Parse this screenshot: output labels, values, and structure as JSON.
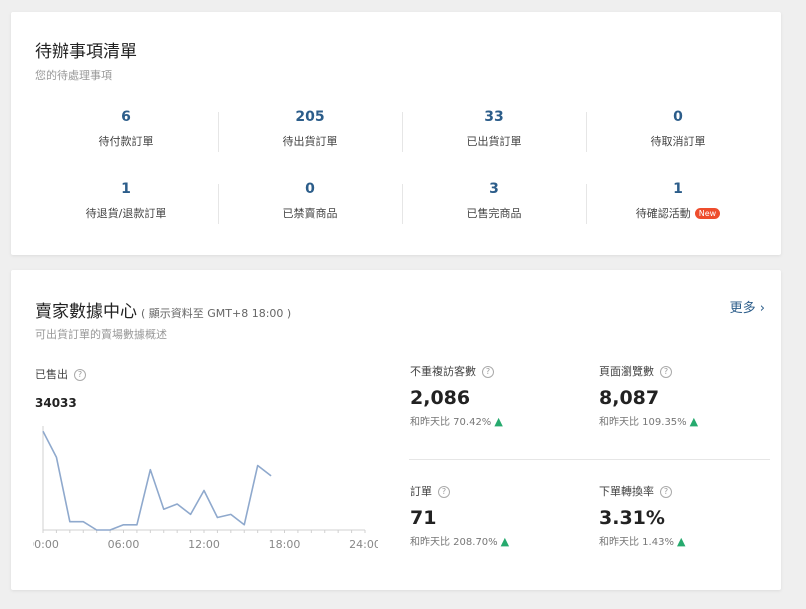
{
  "todo": {
    "title": "待辦事項清單",
    "subtitle": "您的待處理事項",
    "items": [
      {
        "value": "6",
        "label": "待付款訂單"
      },
      {
        "value": "205",
        "label": "待出貨訂單"
      },
      {
        "value": "33",
        "label": "已出貨訂單"
      },
      {
        "value": "0",
        "label": "待取消訂單"
      },
      {
        "value": "1",
        "label": "待退貨/退款訂單"
      },
      {
        "value": "0",
        "label": "已禁賣商品"
      },
      {
        "value": "3",
        "label": "已售完商品"
      },
      {
        "value": "1",
        "label": "待確認活動",
        "badge": "New"
      }
    ]
  },
  "dashboard": {
    "title": "賣家數據中心",
    "note": "( 顯示資料至 GMT+8 18:00 )",
    "subtitle": "可出貨訂單的賣場數據概述",
    "more": "更多 ›",
    "sold_label": "已售出",
    "sold_value": "34033",
    "metrics": [
      {
        "label": "不重複訪客數",
        "value": "2,086",
        "compare": "和昨天比 70.42%"
      },
      {
        "label": "頁面瀏覽數",
        "value": "8,087",
        "compare": "和昨天比 109.35%"
      },
      {
        "label": "訂單",
        "value": "71",
        "compare": "和昨天比 208.70%"
      },
      {
        "label": "下單轉換率",
        "value": "3.31%",
        "compare": "和昨天比 1.43%"
      }
    ]
  },
  "chart_data": {
    "type": "line",
    "x_ticks": [
      "00:00",
      "06:00",
      "12:00",
      "18:00",
      "24:00"
    ],
    "x": [
      0,
      1,
      2,
      3,
      4,
      5,
      6,
      7,
      8,
      9,
      10,
      11,
      12,
      13,
      14,
      15,
      16,
      17
    ],
    "values": [
      95,
      70,
      8,
      8,
      0,
      0,
      5,
      5,
      58,
      20,
      25,
      15,
      38,
      12,
      15,
      5,
      62,
      52
    ],
    "xlim": [
      0,
      24
    ],
    "ylim": [
      0,
      100
    ],
    "color": "#8fa9cd"
  },
  "colors": {
    "accent": "#2c5d8a",
    "up": "#26aa6e",
    "badge": "#ee4d2d"
  }
}
